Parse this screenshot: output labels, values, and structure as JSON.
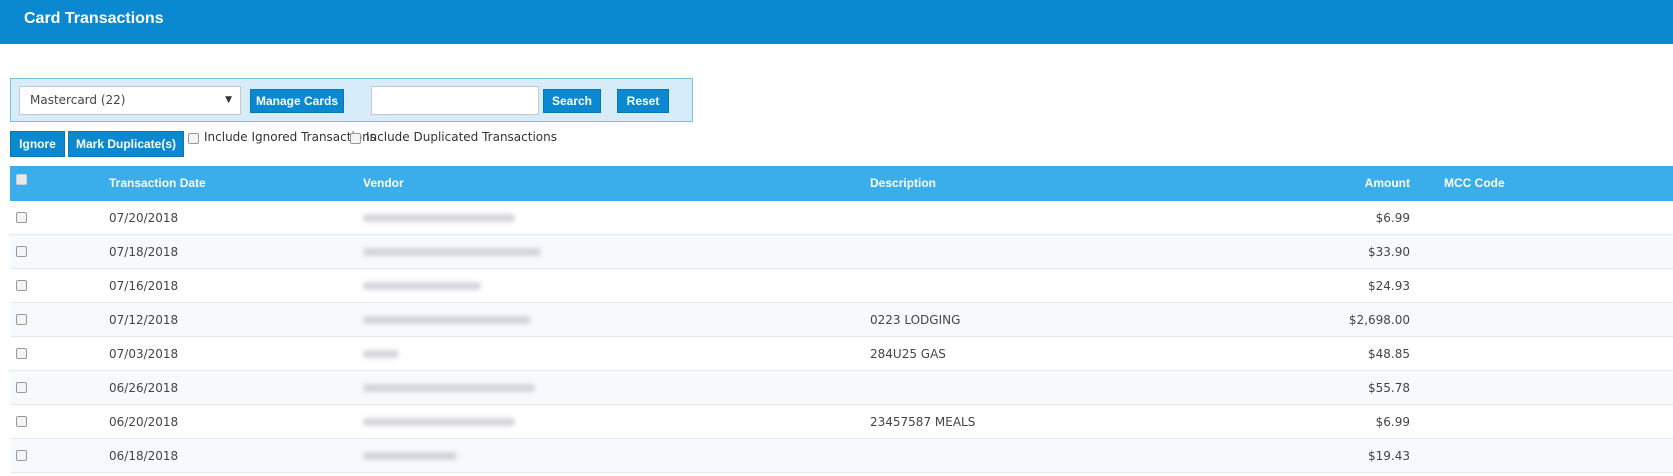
{
  "header": {
    "title": "Card Transactions"
  },
  "filter": {
    "card_select": "Mastercard (22)",
    "manage_cards_label": "Manage Cards",
    "search_value": "",
    "search_label": "Search",
    "reset_label": "Reset"
  },
  "actions": {
    "ignore_label": "Ignore",
    "mark_duplicate_label": "Mark Duplicate(s)",
    "include_ignored_label": "Include Ignored Transactions",
    "include_duplicated_label": "Include Duplicated Transactions",
    "include_ignored_checked": false,
    "include_duplicated_checked": false
  },
  "table": {
    "columns": [
      "Transaction Date",
      "Vendor",
      "Description",
      "Amount",
      "MCC Code"
    ],
    "rows": [
      {
        "date": "07/20/2018",
        "description": "",
        "amount": "$6.99",
        "mcc": ""
      },
      {
        "date": "07/18/2018",
        "description": "",
        "amount": "$33.90",
        "mcc": ""
      },
      {
        "date": "07/16/2018",
        "description": "",
        "amount": "$24.93",
        "mcc": ""
      },
      {
        "date": "07/12/2018",
        "description": "0223 LODGING",
        "amount": "$2,698.00",
        "mcc": ""
      },
      {
        "date": "07/03/2018",
        "description": "284U25 GAS",
        "amount": "$48.85",
        "mcc": ""
      },
      {
        "date": "06/26/2018",
        "description": "",
        "amount": "$55.78",
        "mcc": ""
      },
      {
        "date": "06/20/2018",
        "description": "23457587 MEALS",
        "amount": "$6.99",
        "mcc": ""
      },
      {
        "date": "06/18/2018",
        "description": "",
        "amount": "$19.43",
        "mcc": ""
      }
    ]
  },
  "icons": {
    "dropdown": "chevron-down-icon"
  },
  "colors": {
    "header": "#0a88d0",
    "table_header": "#3aaeea",
    "button": "#0a88d0",
    "panel": "#d7ecf9"
  }
}
